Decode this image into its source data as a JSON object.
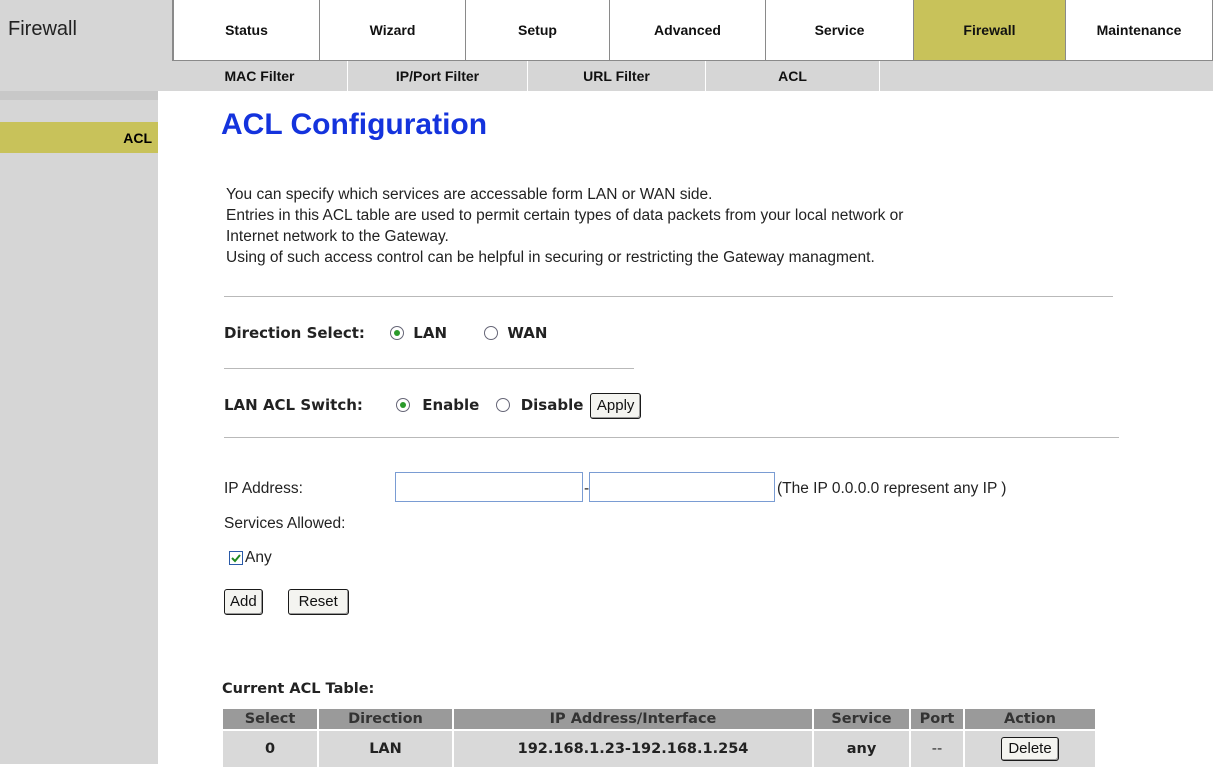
{
  "header": {
    "section_title": "Firewall",
    "main_tabs": [
      {
        "label": "Status"
      },
      {
        "label": "Wizard"
      },
      {
        "label": "Setup"
      },
      {
        "label": "Advanced"
      },
      {
        "label": "Service"
      },
      {
        "label": "Firewall"
      },
      {
        "label": "Maintenance"
      }
    ],
    "active_tab": "Firewall",
    "sub_tabs": [
      {
        "label": "MAC Filter"
      },
      {
        "label": "IP/Port Filter"
      },
      {
        "label": "URL Filter"
      },
      {
        "label": "ACL"
      }
    ]
  },
  "sidebar": {
    "items": [
      {
        "label": "ACL"
      }
    ]
  },
  "main": {
    "title": "ACL Configuration",
    "intro": [
      "You can specify which services are accessable form LAN or WAN side.",
      "Entries in this ACL table are used to permit certain types of data packets from your local network or",
      "Internet network to the Gateway.",
      "Using of such access control can be helpful in securing or restricting the Gateway managment."
    ],
    "direction": {
      "label": "Direction Select:",
      "options": [
        "LAN",
        "WAN"
      ],
      "selected": "LAN"
    },
    "switch": {
      "label": "LAN ACL Switch:",
      "options": [
        "Enable",
        "Disable"
      ],
      "selected": "Enable",
      "apply_label": "Apply"
    },
    "ip": {
      "label": "IP Address:",
      "start_value": "",
      "end_value": "",
      "separator": "-",
      "hint": "(The IP 0.0.0.0 represent any IP )"
    },
    "services": {
      "label": "Services Allowed:",
      "any_label": "Any",
      "any_checked": true
    },
    "buttons": {
      "add": "Add",
      "reset": "Reset"
    },
    "table": {
      "caption": "Current ACL Table:",
      "headers": [
        "Select",
        "Direction",
        "IP Address/Interface",
        "Service",
        "Port",
        "Action"
      ],
      "rows": [
        {
          "select": "0",
          "direction": "LAN",
          "ip": "192.168.1.23-192.168.1.254",
          "service": "any",
          "port": "--",
          "action": "Delete"
        }
      ]
    }
  },
  "colors": {
    "active_tab": "#c8c25a",
    "title_blue": "#1433dd",
    "chrome_gray": "#d6d6d6",
    "table_header": "#9a9a9a",
    "table_cell": "#d9d9d9",
    "radio_dot": "#2a9a2a"
  }
}
